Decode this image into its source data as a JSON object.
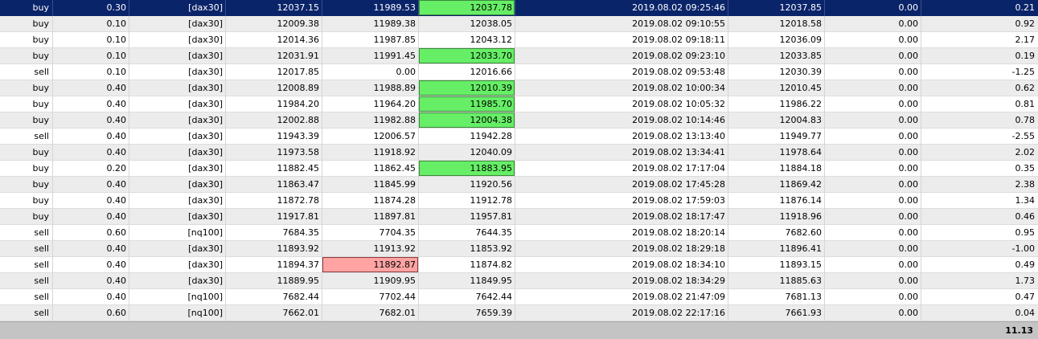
{
  "rows": [
    {
      "type": "buy",
      "volume": "0.30",
      "symbol": "[dax30]",
      "open": "12037.15",
      "sl": "11989.53",
      "tp": "12037.78",
      "time": "2019.08.02 09:25:46",
      "price": "12037.85",
      "commission": "0.00",
      "profit": "0.21",
      "tp_hl": "green",
      "sl_hl": ""
    },
    {
      "type": "buy",
      "volume": "0.10",
      "symbol": "[dax30]",
      "open": "12009.38",
      "sl": "11989.38",
      "tp": "12038.05",
      "time": "2019.08.02 09:10:55",
      "price": "12018.58",
      "commission": "0.00",
      "profit": "0.92",
      "tp_hl": "",
      "sl_hl": ""
    },
    {
      "type": "buy",
      "volume": "0.10",
      "symbol": "[dax30]",
      "open": "12014.36",
      "sl": "11987.85",
      "tp": "12043.12",
      "time": "2019.08.02 09:18:11",
      "price": "12036.09",
      "commission": "0.00",
      "profit": "2.17",
      "tp_hl": "",
      "sl_hl": ""
    },
    {
      "type": "buy",
      "volume": "0.10",
      "symbol": "[dax30]",
      "open": "12031.91",
      "sl": "11991.45",
      "tp": "12033.70",
      "time": "2019.08.02 09:23:10",
      "price": "12033.85",
      "commission": "0.00",
      "profit": "0.19",
      "tp_hl": "green",
      "sl_hl": ""
    },
    {
      "type": "sell",
      "volume": "0.10",
      "symbol": "[dax30]",
      "open": "12017.85",
      "sl": "0.00",
      "tp": "12016.66",
      "time": "2019.08.02 09:53:48",
      "price": "12030.39",
      "commission": "0.00",
      "profit": "-1.25",
      "tp_hl": "",
      "sl_hl": ""
    },
    {
      "type": "buy",
      "volume": "0.40",
      "symbol": "[dax30]",
      "open": "12008.89",
      "sl": "11988.89",
      "tp": "12010.39",
      "time": "2019.08.02 10:00:34",
      "price": "12010.45",
      "commission": "0.00",
      "profit": "0.62",
      "tp_hl": "green",
      "sl_hl": ""
    },
    {
      "type": "buy",
      "volume": "0.40",
      "symbol": "[dax30]",
      "open": "11984.20",
      "sl": "11964.20",
      "tp": "11985.70",
      "time": "2019.08.02 10:05:32",
      "price": "11986.22",
      "commission": "0.00",
      "profit": "0.81",
      "tp_hl": "green",
      "sl_hl": ""
    },
    {
      "type": "buy",
      "volume": "0.40",
      "symbol": "[dax30]",
      "open": "12002.88",
      "sl": "11982.88",
      "tp": "12004.38",
      "time": "2019.08.02 10:14:46",
      "price": "12004.83",
      "commission": "0.00",
      "profit": "0.78",
      "tp_hl": "green",
      "sl_hl": ""
    },
    {
      "type": "sell",
      "volume": "0.40",
      "symbol": "[dax30]",
      "open": "11943.39",
      "sl": "12006.57",
      "tp": "11942.28",
      "time": "2019.08.02 13:13:40",
      "price": "11949.77",
      "commission": "0.00",
      "profit": "-2.55",
      "tp_hl": "",
      "sl_hl": ""
    },
    {
      "type": "buy",
      "volume": "0.40",
      "symbol": "[dax30]",
      "open": "11973.58",
      "sl": "11918.92",
      "tp": "12040.09",
      "time": "2019.08.02 13:34:41",
      "price": "11978.64",
      "commission": "0.00",
      "profit": "2.02",
      "tp_hl": "",
      "sl_hl": ""
    },
    {
      "type": "buy",
      "volume": "0.20",
      "symbol": "[dax30]",
      "open": "11882.45",
      "sl": "11862.45",
      "tp": "11883.95",
      "time": "2019.08.02 17:17:04",
      "price": "11884.18",
      "commission": "0.00",
      "profit": "0.35",
      "tp_hl": "green",
      "sl_hl": ""
    },
    {
      "type": "buy",
      "volume": "0.40",
      "symbol": "[dax30]",
      "open": "11863.47",
      "sl": "11845.99",
      "tp": "11920.56",
      "time": "2019.08.02 17:45:28",
      "price": "11869.42",
      "commission": "0.00",
      "profit": "2.38",
      "tp_hl": "",
      "sl_hl": ""
    },
    {
      "type": "buy",
      "volume": "0.40",
      "symbol": "[dax30]",
      "open": "11872.78",
      "sl": "11874.28",
      "tp": "11912.78",
      "time": "2019.08.02 17:59:03",
      "price": "11876.14",
      "commission": "0.00",
      "profit": "1.34",
      "tp_hl": "",
      "sl_hl": ""
    },
    {
      "type": "buy",
      "volume": "0.40",
      "symbol": "[dax30]",
      "open": "11917.81",
      "sl": "11897.81",
      "tp": "11957.81",
      "time": "2019.08.02 18:17:47",
      "price": "11918.96",
      "commission": "0.00",
      "profit": "0.46",
      "tp_hl": "",
      "sl_hl": ""
    },
    {
      "type": "sell",
      "volume": "0.60",
      "symbol": "[nq100]",
      "open": "7684.35",
      "sl": "7704.35",
      "tp": "7644.35",
      "time": "2019.08.02 18:20:14",
      "price": "7682.60",
      "commission": "0.00",
      "profit": "0.95",
      "tp_hl": "",
      "sl_hl": ""
    },
    {
      "type": "sell",
      "volume": "0.40",
      "symbol": "[dax30]",
      "open": "11893.92",
      "sl": "11913.92",
      "tp": "11853.92",
      "time": "2019.08.02 18:29:18",
      "price": "11896.41",
      "commission": "0.00",
      "profit": "-1.00",
      "tp_hl": "",
      "sl_hl": ""
    },
    {
      "type": "sell",
      "volume": "0.40",
      "symbol": "[dax30]",
      "open": "11894.37",
      "sl": "11892.87",
      "tp": "11874.82",
      "time": "2019.08.02 18:34:10",
      "price": "11893.15",
      "commission": "0.00",
      "profit": "0.49",
      "tp_hl": "",
      "sl_hl": "red"
    },
    {
      "type": "sell",
      "volume": "0.40",
      "symbol": "[dax30]",
      "open": "11889.95",
      "sl": "11909.95",
      "tp": "11849.95",
      "time": "2019.08.02 18:34:29",
      "price": "11885.63",
      "commission": "0.00",
      "profit": "1.73",
      "tp_hl": "",
      "sl_hl": ""
    },
    {
      "type": "sell",
      "volume": "0.40",
      "symbol": "[nq100]",
      "open": "7682.44",
      "sl": "7702.44",
      "tp": "7642.44",
      "time": "2019.08.02 21:47:09",
      "price": "7681.13",
      "commission": "0.00",
      "profit": "0.47",
      "tp_hl": "",
      "sl_hl": ""
    },
    {
      "type": "sell",
      "volume": "0.60",
      "symbol": "[nq100]",
      "open": "7662.01",
      "sl": "7682.01",
      "tp": "7659.39",
      "time": "2019.08.02 22:17:16",
      "price": "7661.93",
      "commission": "0.00",
      "profit": "0.04",
      "tp_hl": "",
      "sl_hl": ""
    }
  ],
  "selected_row": 0,
  "footer": {
    "total_profit": "11.13"
  },
  "colors": {
    "selected_bg": "#0a246a",
    "tp_highlight": "#66ee66",
    "sl_highlight": "#ffa3a3",
    "footer_bg": "#c4c4c4"
  }
}
